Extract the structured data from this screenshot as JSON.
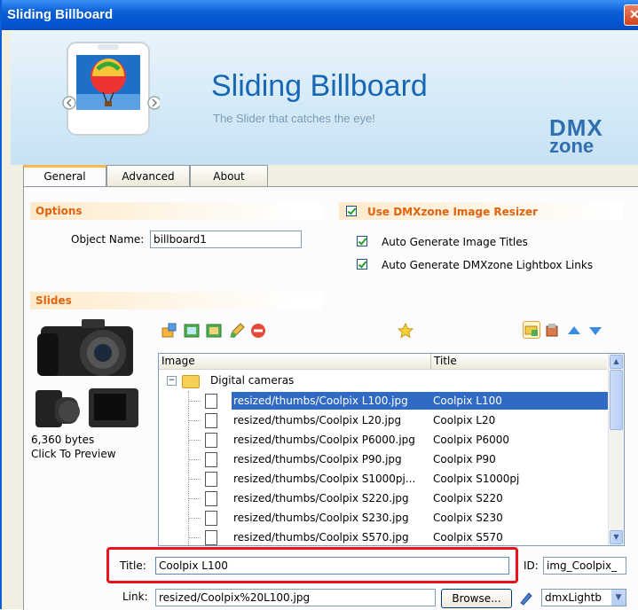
{
  "window": {
    "title": "Sliding Billboard",
    "close": "✕"
  },
  "header": {
    "title": "Sliding Billboard",
    "subtitle": "The Slider that catches the eye!",
    "brand_line1": "DMX",
    "brand_line2": "zone"
  },
  "tabs": [
    {
      "label": "General",
      "active": true
    },
    {
      "label": "Advanced"
    },
    {
      "label": "About"
    }
  ],
  "options": {
    "heading": "Options",
    "resizer_label": "Use DMXzone Image Resizer",
    "object_name_label": "Object Name:",
    "object_name_value": "billboard1",
    "auto_titles_label": "Auto Generate Image Titles",
    "auto_links_label": "Auto Generate DMXzone Lightbox Links"
  },
  "slides": {
    "heading": "Slides",
    "preview_size": "6,360 bytes",
    "preview_hint": "Click To Preview",
    "columns": [
      "Image",
      "Title"
    ],
    "folder": "Digital cameras",
    "rows": [
      {
        "image": "resized/thumbs/Coolpix L100.jpg",
        "title": "Coolpix L100",
        "selected": true
      },
      {
        "image": "resized/thumbs/Coolpix L20.jpg",
        "title": "Coolpix L20"
      },
      {
        "image": "resized/thumbs/Coolpix P6000.jpg",
        "title": "Coolpix P6000"
      },
      {
        "image": "resized/thumbs/Coolpix P90.jpg",
        "title": "Coolpix P90"
      },
      {
        "image": "resized/thumbs/Coolpix S1000pj...",
        "title": "Coolpix S1000pj"
      },
      {
        "image": "resized/thumbs/Coolpix S220.jpg",
        "title": "Coolpix S220"
      },
      {
        "image": "resized/thumbs/Coolpix S230.jpg",
        "title": "Coolpix S230"
      },
      {
        "image": "resized/thumbs/Coolpix S570.jpg",
        "title": "Coolpix S570"
      }
    ]
  },
  "fields": {
    "title_label": "Title:",
    "title_value": "Coolpix L100",
    "id_label": "ID:",
    "id_value": "img_Coolpix_",
    "link_label": "Link:",
    "link_value": "resized/Coolpix%20L100.jpg",
    "browse_label": "Browse...",
    "link_type_value": "dmxLightb"
  },
  "colors": {
    "accent": "#e0620d",
    "selection": "#316ac5",
    "highlight": "#e8131b",
    "title_blue": "#1767b4"
  }
}
